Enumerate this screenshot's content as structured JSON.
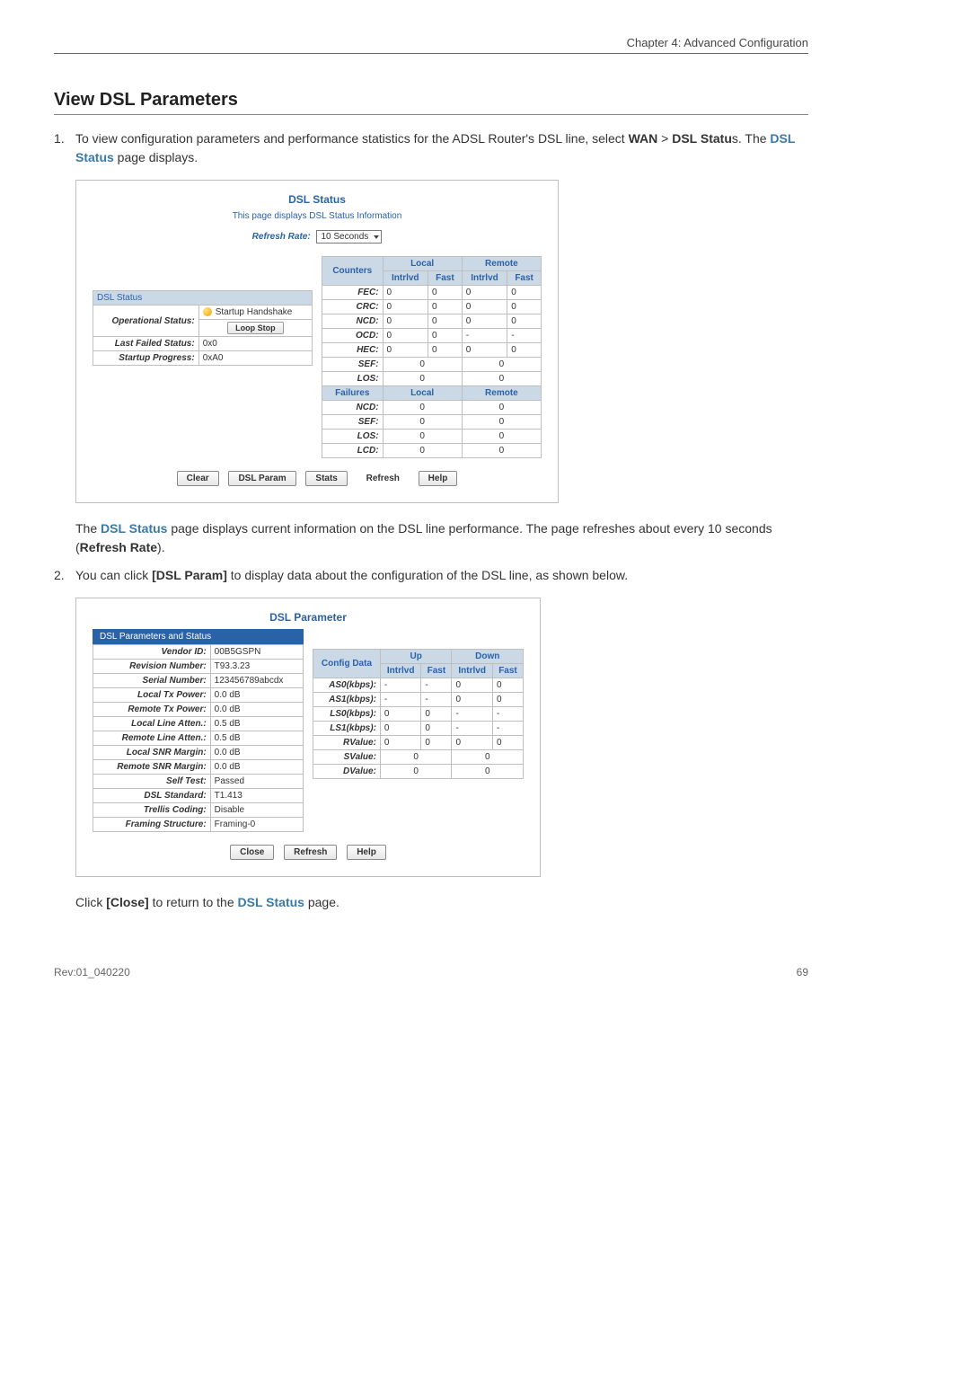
{
  "page": {
    "chapter_header": "Chapter 4: Advanced Configuration",
    "section_title": "View DSL Parameters",
    "step1_num": "1.",
    "step1_a": "To view configuration parameters and performance statistics for the ADSL Router's DSL line, select ",
    "step1_b": "WAN",
    "step1_c": " > ",
    "step1_d": "DSL Statu",
    "step1_e": "s. The ",
    "step1_f": "DSL Status",
    "step1_g": " page displays.",
    "after_panel1_a": "The ",
    "after_panel1_b": "DSL Status",
    "after_panel1_c": " page displays current information on the DSL line performance. The page refreshes about every 10 seconds (",
    "after_panel1_d": "Refresh Rate",
    "after_panel1_e": ").",
    "step2_num": "2.",
    "step2_a": "You can click ",
    "step2_b": "[DSL Param]",
    "step2_c": " to display data about the configuration of the DSL line, as shown below.",
    "closing_a": "Click ",
    "closing_b": "[Close]",
    "closing_c": " to return to the ",
    "closing_d": "DSL Status",
    "closing_e": " page.",
    "footer_left": "Rev:01_040220",
    "footer_right": "69"
  },
  "dsl_status": {
    "title": "DSL Status",
    "subtitle": "This page displays DSL Status Information",
    "refresh_label": "Refresh Rate:",
    "refresh_value": "10 Seconds",
    "section_band": "DSL Status",
    "op_status_label": "Operational Status:",
    "op_status_val": "Startup Handshake",
    "loop_stop": "Loop Stop",
    "last_failed_label": "Last Failed Status:",
    "last_failed_val": "0x0",
    "startup_label": "Startup Progress:",
    "startup_val": "0xA0",
    "counters_hdr": "Counters",
    "local_hdr": "Local",
    "remote_hdr": "Remote",
    "intrlvd": "Intrlvd",
    "fast": "Fast",
    "rows_counters": [
      {
        "l": "FEC:",
        "a": "0",
        "b": "0",
        "c": "0",
        "d": "0"
      },
      {
        "l": "CRC:",
        "a": "0",
        "b": "0",
        "c": "0",
        "d": "0"
      },
      {
        "l": "NCD:",
        "a": "0",
        "b": "0",
        "c": "0",
        "d": "0"
      },
      {
        "l": "OCD:",
        "a": "0",
        "b": "0",
        "c": "-",
        "d": "-"
      },
      {
        "l": "HEC:",
        "a": "0",
        "b": "0",
        "c": "0",
        "d": "0"
      }
    ],
    "rows_span": [
      {
        "l": "SEF:",
        "a": "0",
        "b": "0"
      },
      {
        "l": "LOS:",
        "a": "0",
        "b": "0"
      }
    ],
    "failures_hdr": "Failures",
    "failures_rows": [
      {
        "l": "NCD:",
        "a": "0",
        "b": "0"
      },
      {
        "l": "SEF:",
        "a": "0",
        "b": "0"
      },
      {
        "l": "LOS:",
        "a": "0",
        "b": "0"
      },
      {
        "l": "LCD:",
        "a": "0",
        "b": "0"
      }
    ],
    "btn_clear": "Clear",
    "btn_dslparam": "DSL Param",
    "btn_stats": "Stats",
    "btn_refresh": "Refresh",
    "btn_help": "Help"
  },
  "dsl_param": {
    "title": "DSL Parameter",
    "tab": "DSL Parameters and Status",
    "rows": [
      {
        "l": "Vendor ID:",
        "v": "00B5GSPN"
      },
      {
        "l": "Revision Number:",
        "v": "T93.3.23"
      },
      {
        "l": "Serial Number:",
        "v": "123456789abcdx"
      },
      {
        "l": "Local Tx Power:",
        "v": "0.0 dB"
      },
      {
        "l": "Remote Tx Power:",
        "v": "0.0 dB"
      },
      {
        "l": "Local Line Atten.:",
        "v": "0.5 dB"
      },
      {
        "l": "Remote Line Atten.:",
        "v": "0.5 dB"
      },
      {
        "l": "Local SNR Margin:",
        "v": "0.0 dB"
      },
      {
        "l": "Remote SNR Margin:",
        "v": "0.0 dB"
      },
      {
        "l": "Self Test:",
        "v": "Passed"
      },
      {
        "l": "DSL Standard:",
        "v": "T1.413"
      },
      {
        "l": "Trellis Coding:",
        "v": "Disable"
      },
      {
        "l": "Framing Structure:",
        "v": "Framing-0"
      }
    ],
    "config_hdr": "Config Data",
    "up_hdr": "Up",
    "down_hdr": "Down",
    "intrlvd": "Intrlvd",
    "fast": "Fast",
    "cfg_rows": [
      {
        "l": "AS0(kbps):",
        "a": "-",
        "b": "-",
        "c": "0",
        "d": "0"
      },
      {
        "l": "AS1(kbps):",
        "a": "-",
        "b": "-",
        "c": "0",
        "d": "0"
      },
      {
        "l": "LS0(kbps):",
        "a": "0",
        "b": "0",
        "c": "-",
        "d": "-"
      },
      {
        "l": "LS1(kbps):",
        "a": "0",
        "b": "0",
        "c": "-",
        "d": "-"
      },
      {
        "l": "RValue:",
        "a": "0",
        "b": "0",
        "c": "0",
        "d": "0"
      }
    ],
    "cfg_span": [
      {
        "l": "SValue:",
        "a": "0",
        "b": "0"
      },
      {
        "l": "DValue:",
        "a": "0",
        "b": "0"
      }
    ],
    "btn_close": "Close",
    "btn_refresh": "Refresh",
    "btn_help": "Help"
  }
}
